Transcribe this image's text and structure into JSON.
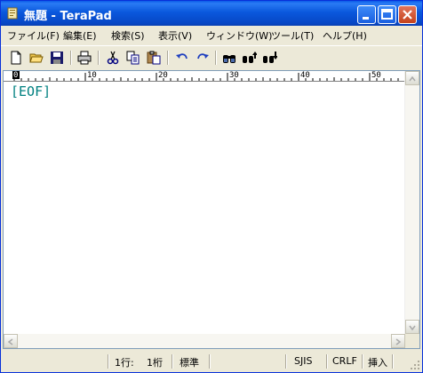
{
  "window": {
    "title": "無題 - TeraPad"
  },
  "menu": [
    {
      "label": "ファイル(F)"
    },
    {
      "label": "編集(E)"
    },
    {
      "label": "検索(S)"
    },
    {
      "label": "表示(V)"
    },
    {
      "label": "ウィンドウ(W)"
    },
    {
      "label": "ツール(T)"
    },
    {
      "label": "ヘルプ(H)"
    }
  ],
  "toolbar": {
    "icons": [
      "new-file-icon",
      "open-folder-icon",
      "save-icon",
      "print-icon",
      "cut-icon",
      "copy-icon",
      "paste-icon",
      "undo-icon",
      "redo-icon",
      "find-icon",
      "find-prev-icon",
      "find-next-icon"
    ]
  },
  "ruler": {
    "ticks": [
      "0",
      "10",
      "20",
      "30",
      "40",
      "50"
    ]
  },
  "editor": {
    "eof_marker": "[EOF]"
  },
  "status": {
    "line": "1行:",
    "column": "1桁",
    "mode": "標準",
    "encoding": "SJIS",
    "line_ending": "CRLF",
    "insert_mode": "挿入"
  },
  "colors": {
    "eof": "#008080",
    "title_bar": "#0a58dd",
    "chrome": "#ece9d8"
  }
}
